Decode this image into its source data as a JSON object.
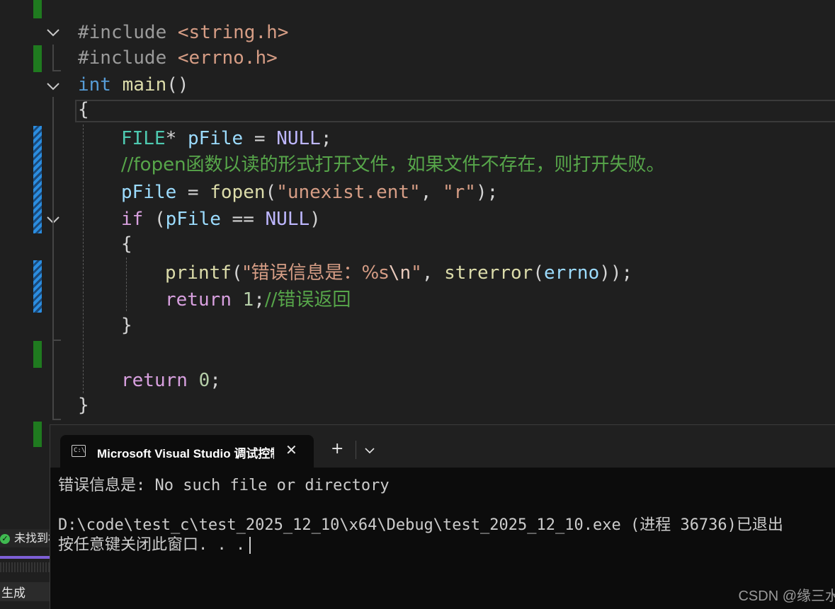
{
  "editor": {
    "lines": [
      {
        "id": "l1",
        "tokens": [
          [
            "pp",
            "#include "
          ],
          [
            "str",
            "<string.h>"
          ]
        ]
      },
      {
        "id": "l2",
        "tokens": [
          [
            "pp",
            "#include "
          ],
          [
            "str",
            "<errno.h>"
          ]
        ]
      },
      {
        "id": "l3",
        "tokens": [
          [
            "kw",
            "int "
          ],
          [
            "fn",
            "main"
          ],
          [
            "",
            "()"
          ]
        ]
      },
      {
        "id": "l4",
        "tokens": [
          [
            "",
            "{"
          ]
        ]
      },
      {
        "id": "l5",
        "tokens": [
          [
            "type",
            "FILE"
          ],
          [
            "",
            "* "
          ],
          [
            "var",
            "pFile"
          ],
          [
            "",
            " = "
          ],
          [
            "mac",
            "NULL"
          ],
          [
            "",
            ";"
          ]
        ]
      },
      {
        "id": "l6",
        "tokens": [
          [
            "cm",
            "//fopen函数以读的形式打开文件，如果文件不存在，则打开失败。"
          ]
        ]
      },
      {
        "id": "l7",
        "tokens": [
          [
            "var",
            "pFile"
          ],
          [
            "",
            " = "
          ],
          [
            "fn",
            "fopen"
          ],
          [
            "",
            "("
          ],
          [
            "str",
            "\"unexist.ent\""
          ],
          [
            "",
            ", "
          ],
          [
            "str",
            "\"r\""
          ],
          [
            "",
            ");"
          ]
        ]
      },
      {
        "id": "l8",
        "tokens": [
          [
            "kw2",
            "if"
          ],
          [
            "",
            " ("
          ],
          [
            "var",
            "pFile"
          ],
          [
            "",
            " == "
          ],
          [
            "mac",
            "NULL"
          ],
          [
            "",
            ")"
          ]
        ]
      },
      {
        "id": "l9",
        "tokens": [
          [
            "",
            "{"
          ]
        ]
      },
      {
        "id": "l10",
        "tokens": [
          [
            "fn",
            "printf"
          ],
          [
            "",
            "("
          ],
          [
            "str",
            "\"错误信息是：%s"
          ],
          [
            "esc",
            "\\n"
          ],
          [
            "str",
            "\""
          ],
          [
            "",
            ", "
          ],
          [
            "fn",
            "strerror"
          ],
          [
            "",
            "("
          ],
          [
            "var",
            "errno"
          ],
          [
            "",
            "));"
          ]
        ]
      },
      {
        "id": "l11",
        "tokens": [
          [
            "kw2",
            "return "
          ],
          [
            "num",
            "1"
          ],
          [
            "",
            ";"
          ],
          [
            "cm",
            "//错误返回"
          ]
        ]
      },
      {
        "id": "l12",
        "tokens": [
          [
            "",
            "}"
          ]
        ]
      },
      {
        "id": "l13",
        "tokens": []
      },
      {
        "id": "l14",
        "tokens": [
          [
            "kw2",
            "return "
          ],
          [
            "num",
            "0"
          ],
          [
            "",
            ";"
          ]
        ]
      },
      {
        "id": "l15",
        "tokens": [
          [
            "",
            "}"
          ]
        ]
      }
    ]
  },
  "terminal": {
    "tab_title": "Microsoft Visual Studio 调试控制台",
    "tab_icon_text": "C:\\",
    "close_glyph": "✕",
    "new_tab_glyph": "+",
    "output": [
      "错误信息是: No such file or directory",
      "",
      "D:\\code\\test_c\\test_2025_12_10\\x64\\Debug\\test_2025_12_10.exe (进程 36736)已退出",
      "按任意键关闭此窗口. . ."
    ]
  },
  "side": {
    "status_text": "未找到相关问题",
    "build_tab": "生成"
  },
  "watermark": "CSDN @缘三水",
  "colors": {
    "background": "#1f1f1f",
    "terminal_bg": "#0c0c0c",
    "comment": "#57a64a",
    "keyword": "#569cd6",
    "string": "#d69d85",
    "change_added": "#1f7a1f",
    "change_modified": "#2b8de0"
  }
}
